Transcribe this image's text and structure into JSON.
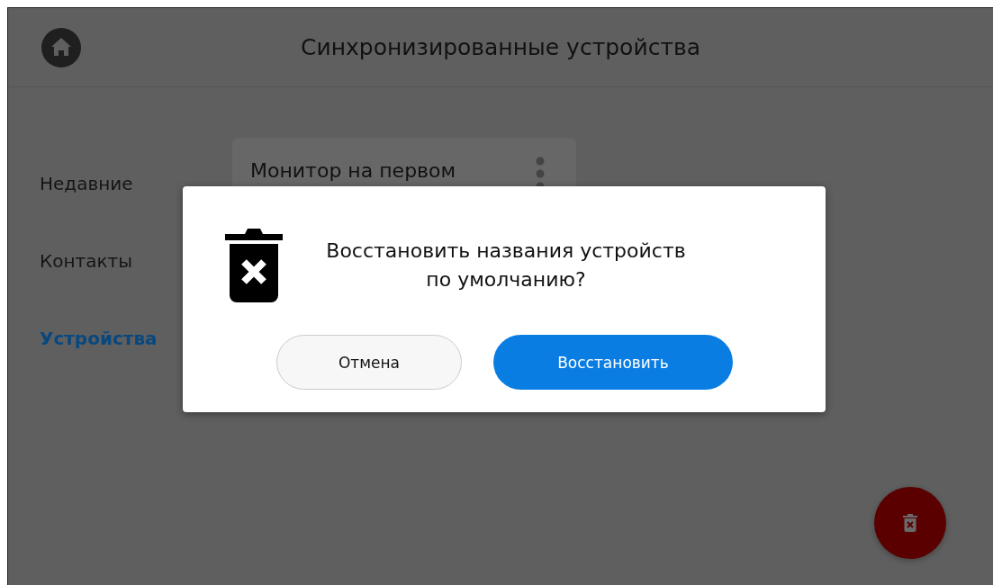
{
  "header": {
    "title": "Синхронизированные устройства"
  },
  "sidebar": {
    "items": [
      {
        "label": "Недавние",
        "selected": false
      },
      {
        "label": "Контакты",
        "selected": false
      },
      {
        "label": "Устройства",
        "selected": true
      }
    ]
  },
  "device_card": {
    "title": "Монитор на первом"
  },
  "dialog": {
    "message": "Восстановить названия устройств по умолчанию?",
    "buttons": [
      {
        "label": "Отмена",
        "kind": "secondary"
      },
      {
        "label": "Восстановить",
        "kind": "primary"
      }
    ]
  }
}
